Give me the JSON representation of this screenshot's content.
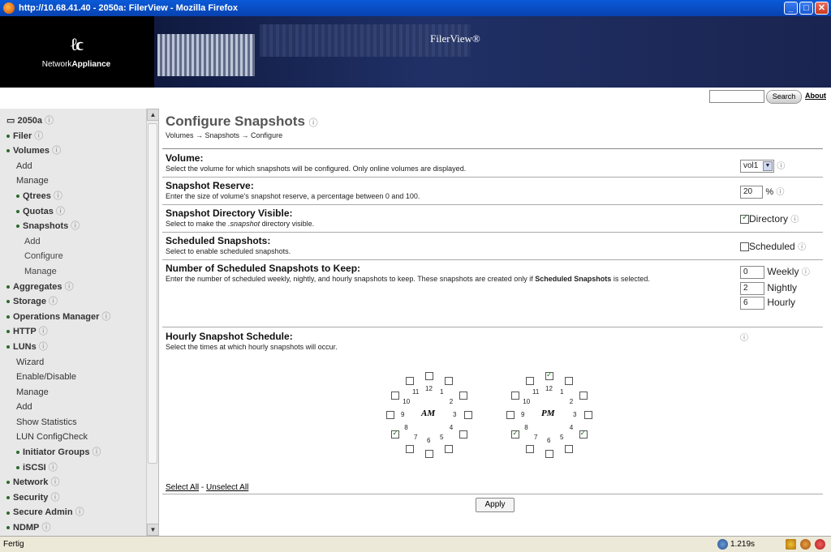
{
  "window": {
    "title": "http://10.68.41.40 - 2050a: FilerView - Mozilla Firefox"
  },
  "header": {
    "logo_mark": "ℓϲ",
    "logo_text_a": "Network",
    "logo_text_b": "Appliance",
    "app_title": "FilerView®",
    "search_label": "Search",
    "about_label": "About"
  },
  "sidebar": {
    "items": [
      {
        "label": "2050a",
        "level": 0,
        "icon": true
      },
      {
        "label": "Filer",
        "level": 0,
        "bullet": true
      },
      {
        "label": "Volumes",
        "level": 0,
        "bullet": true
      },
      {
        "label": "Add",
        "level": 1
      },
      {
        "label": "Manage",
        "level": 1
      },
      {
        "label": "Qtrees",
        "level": 1,
        "bullet": true,
        "bold": true
      },
      {
        "label": "Quotas",
        "level": 1,
        "bullet": true,
        "bold": true
      },
      {
        "label": "Snapshots",
        "level": 1,
        "bullet": true,
        "bold": true
      },
      {
        "label": "Add",
        "level": 2
      },
      {
        "label": "Configure",
        "level": 2
      },
      {
        "label": "Manage",
        "level": 2
      },
      {
        "label": "Aggregates",
        "level": 0,
        "bullet": true
      },
      {
        "label": "Storage",
        "level": 0,
        "bullet": true
      },
      {
        "label": "Operations Manager",
        "level": 0,
        "bullet": true
      },
      {
        "label": "HTTP",
        "level": 0,
        "bullet": true
      },
      {
        "label": "LUNs",
        "level": 0,
        "bullet": true
      },
      {
        "label": "Wizard",
        "level": 1
      },
      {
        "label": "Enable/Disable",
        "level": 1
      },
      {
        "label": "Manage",
        "level": 1
      },
      {
        "label": "Add",
        "level": 1
      },
      {
        "label": "Show Statistics",
        "level": 1
      },
      {
        "label": "LUN ConfigCheck",
        "level": 1
      },
      {
        "label": "Initiator Groups",
        "level": 1,
        "bullet": true,
        "bold": true
      },
      {
        "label": "iSCSI",
        "level": 1,
        "bullet": true,
        "bold": true
      },
      {
        "label": "Network",
        "level": 0,
        "bullet": true
      },
      {
        "label": "Security",
        "level": 0,
        "bullet": true
      },
      {
        "label": "Secure Admin",
        "level": 0,
        "bullet": true
      },
      {
        "label": "NDMP",
        "level": 0,
        "bullet": true
      }
    ]
  },
  "main": {
    "title": "Configure Snapshots",
    "breadcrumb": "Volumes → Snapshots → Configure",
    "volume": {
      "label": "Volume:",
      "desc": "Select the volume for which snapshots will be configured. Only online volumes are displayed.",
      "value": "vol1"
    },
    "reserve": {
      "label": "Snapshot Reserve:",
      "desc": "Enter the size of volume's snapshot reserve, a percentage between 0 and 100.",
      "value": "20",
      "unit": "%"
    },
    "dirvisible": {
      "label": "Snapshot Directory Visible:",
      "desc_a": "Select to make the ",
      "desc_em": ".snapshot",
      "desc_b": " directory visible.",
      "checkbox_label": "Directory",
      "checked": true
    },
    "scheduled": {
      "label": "Scheduled Snapshots:",
      "desc": "Select to enable scheduled snapshots.",
      "checkbox_label": "Scheduled",
      "checked": false
    },
    "keep": {
      "label": "Number of Scheduled Snapshots to Keep:",
      "desc_a": "Enter the number of scheduled weekly, nightly, and hourly snapshots to keep. These snapshots are created only if ",
      "desc_b": "Scheduled Snapshots",
      "desc_c": " is selected.",
      "weekly": "0",
      "weekly_label": "Weekly",
      "nightly": "2",
      "nightly_label": "Nightly",
      "hourly": "6",
      "hourly_label": "Hourly"
    },
    "hourly": {
      "label": "Hourly Snapshot Schedule:",
      "desc": "Select the times at which hourly snapshots will occur."
    },
    "am_label": "AM",
    "pm_label": "PM",
    "am_checked": [
      8
    ],
    "pm_checked": [
      4,
      8,
      12
    ],
    "select_all": "Select All",
    "sep": "-",
    "unselect_all": "Unselect All",
    "apply": "Apply"
  },
  "status": {
    "text": "Fertig",
    "timing": "1.219s"
  }
}
